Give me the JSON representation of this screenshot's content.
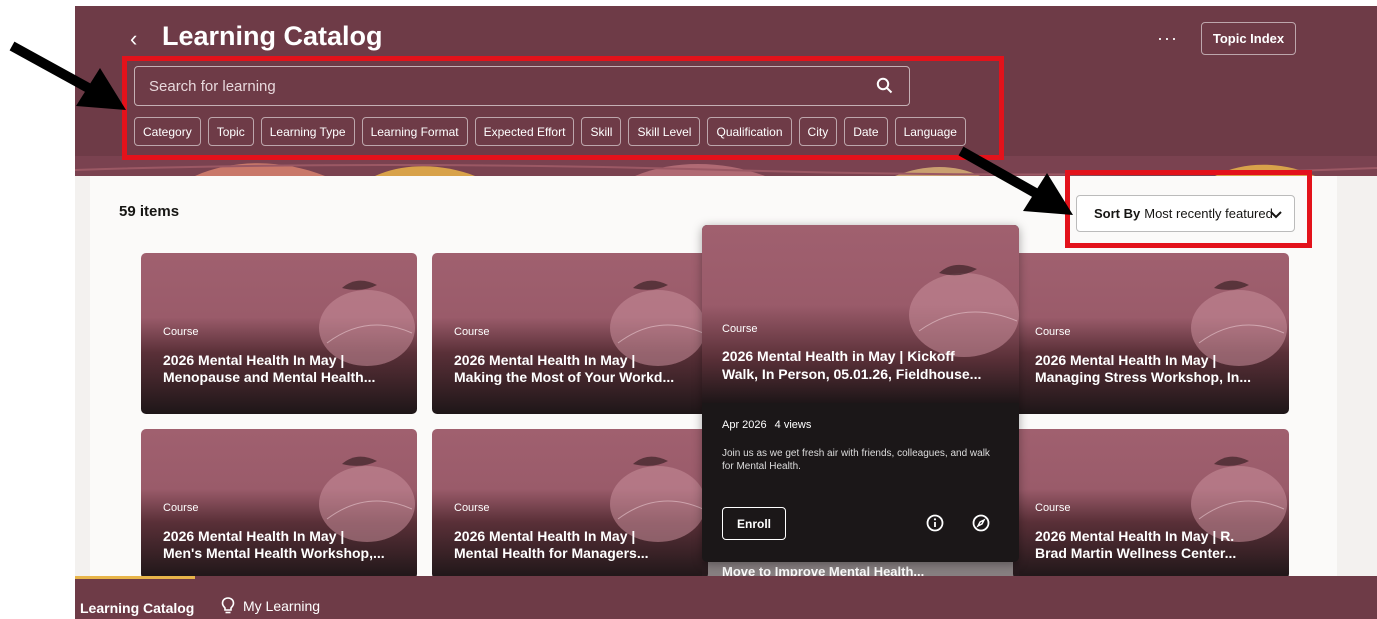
{
  "header": {
    "back_icon": "chevron-left",
    "title": "Learning Catalog",
    "more_label": "···",
    "topic_index_label": "Topic Index"
  },
  "search": {
    "placeholder": "Search for learning",
    "icon": "search-icon"
  },
  "filters": [
    "Category",
    "Topic",
    "Learning Type",
    "Learning Format",
    "Expected Effort",
    "Skill",
    "Skill Level",
    "Qualification",
    "City",
    "Date",
    "Language"
  ],
  "results": {
    "count_label": "59 items",
    "sort_prefix": "Sort By",
    "sort_value": "Most recently featured"
  },
  "cards": [
    {
      "type": "Course",
      "title_line1": "2026 Mental Health In May |",
      "title_line2": "Menopause and Mental Health..."
    },
    {
      "type": "Course",
      "title_line1": "2026 Mental Health In May |",
      "title_line2": "Making the Most of Your Workd..."
    },
    {
      "type": "Course",
      "title_line1": "2026 Mental Health In May |",
      "title_line2": "Managing Stress Workshop, In..."
    },
    {
      "type": "Course",
      "title_line1": "2026 Mental Health In May |",
      "title_line2": "Men's Mental Health Workshop,..."
    },
    {
      "type": "Course",
      "title_line1": "2026 Mental Health In May |",
      "title_line2": "Mental Health for Managers..."
    },
    {
      "type": "Course",
      "title_line1": "2026 Mental Health In May | R.",
      "title_line2": "Brad Martin Wellness Center..."
    }
  ],
  "popover": {
    "type": "Course",
    "title_line1": "2026 Mental Health in May | Kickoff",
    "title_line2": "Walk, In Person, 05.01.26, Fieldhouse...",
    "date": "Apr 2026",
    "views": "4 views",
    "description": "Join us as we get fresh air with friends, colleagues, and walk for Mental Health.",
    "enroll_label": "Enroll",
    "peek_text": "Move to Improve Mental Health..."
  },
  "footer": {
    "tab_catalog": "Learning Catalog",
    "tab_my_learning": "My Learning"
  },
  "colors": {
    "brand": "#6e3b47",
    "card": "#a0606f",
    "highlight_box": "#e3121b"
  }
}
